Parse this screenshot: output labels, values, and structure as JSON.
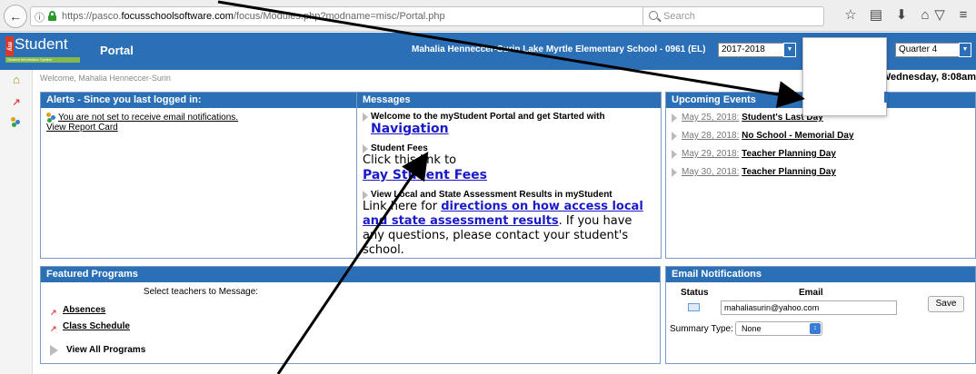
{
  "browser": {
    "url_prefix": "https://pasco.",
    "url_domain": "focusschoolsoftware.com",
    "url_suffix": "/focus/Modules.php?modname=misc/Portal.php",
    "search_placeholder": "Search"
  },
  "header": {
    "logo_my": "my",
    "logo_student": "Student",
    "logo_tagline": "Student Information System",
    "portal_title": "Portal",
    "user_info": "Mahalia Henneccer-Surin   Lake Myrtle Elementary School - 0961 (EL)",
    "year": "2017-2018",
    "quarter": "Quarter 4"
  },
  "welcome": {
    "text": "Welcome, Mahalia Henneccer-Surin",
    "date": "Wednesday, 8:08am"
  },
  "alerts": {
    "title": "Alerts - Since you last logged in:",
    "notification_text": "You are not set to receive email notifications.",
    "report_card_link": "View Report Card"
  },
  "messages": {
    "title": "Messages",
    "items": [
      {
        "title": "Welcome to the myStudent Portal and get Started with",
        "link": "Navigation"
      },
      {
        "title": "Student Fees",
        "body": "Click this link to",
        "link": "Pay Student Fees"
      },
      {
        "title": "View Local and State Assessment Results in myStudent",
        "body_pre": "Link here for ",
        "link": "directions on how access local and state assessment results",
        "body_post": ". If you have any questions, please contact your student's school."
      }
    ]
  },
  "events": {
    "title": "Upcoming Events",
    "items": [
      {
        "date": "May 25, 2018:",
        "name": "Student's Last Day"
      },
      {
        "date": "May 28, 2018:",
        "name": "No School - Memorial Day"
      },
      {
        "date": "May 29, 2018:",
        "name": "Teacher Planning Day"
      },
      {
        "date": "May 30, 2018:",
        "name": "Teacher Planning Day"
      }
    ]
  },
  "programs": {
    "title": "Featured Programs",
    "select_teachers": "Select teachers to Message:",
    "items": [
      "Absences",
      "Class Schedule"
    ],
    "view_all": "View All Programs"
  },
  "email": {
    "title": "Email Notifications",
    "status_header": "Status",
    "email_header": "Email",
    "email_value": "mahaliasurin@yahoo.com",
    "save_label": "Save",
    "summary_label": "Summary Type:",
    "summary_value": "None"
  },
  "colors": {
    "header_blue": "#2b6fb6",
    "link_blue": "#1a1ac8"
  }
}
